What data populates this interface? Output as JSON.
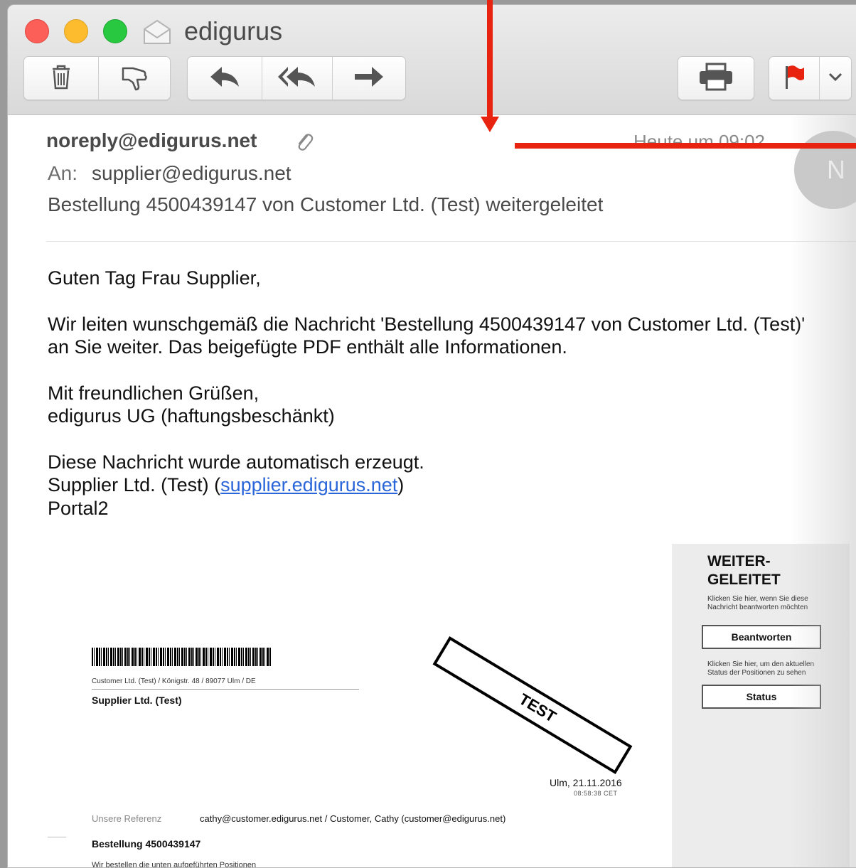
{
  "window": {
    "title": "edigurus",
    "icon": "envelope-icon"
  },
  "toolbar": {
    "buttons": [
      {
        "name": "delete-button",
        "icon": "trash-icon"
      },
      {
        "name": "junk-button",
        "icon": "thumbs-down-icon"
      },
      {
        "name": "reply-button",
        "icon": "reply-arrow-icon"
      },
      {
        "name": "reply-all-button",
        "icon": "reply-all-icon"
      },
      {
        "name": "forward-button",
        "icon": "forward-arrow-icon"
      },
      {
        "name": "print-button",
        "icon": "printer-icon"
      },
      {
        "name": "flag-button",
        "icon": "flag-icon"
      },
      {
        "name": "flag-menu-button",
        "icon": "chevron-down-icon"
      }
    ],
    "flag_color": "#e8230f"
  },
  "message": {
    "from": "noreply@edigurus.net",
    "to_label": "An:",
    "to": "supplier@edigurus.net",
    "subject": "Bestellung 4500439147 von Customer Ltd. (Test) weitergeleitet",
    "date": "Heute um 09:02",
    "avatar_initial": "N",
    "body": {
      "greeting": "Guten Tag Frau Supplier,",
      "p1_line1": "Wir leiten wunschgemäß die Nachricht 'Bestellung 4500439147 von Customer Ltd. (Test)'",
      "p1_line2": "an Sie weiter. Das beigefügte PDF enthält alle Informationen.",
      "closing": "Mit freundlichen Grüßen,",
      "company": "edigurus UG (haftungsbeschänkt)",
      "auto_note": "Diese Nachricht wurde automatisch erzeugt.",
      "portal_prefix": "Supplier Ltd. (Test) (",
      "portal_link": "supplier.edigurus.net",
      "portal_suffix": ")",
      "portal_name": "Portal2"
    }
  },
  "pdf": {
    "sender_line": "Customer Ltd. (Test) / Königstr. 48 / 89077 Ulm / DE",
    "recipient": "Supplier Ltd. (Test)",
    "stamp": "TEST",
    "city_date": "Ulm, 21.11.2016",
    "time": "08:58:38    CET",
    "ref_label": "Unsere Referenz",
    "ref_value": "cathy@customer.edigurus.net / Customer, Cathy (customer@edigurus.net)",
    "order": "Bestellung 4500439147",
    "cutoff_text": "Wir bestellen die unten aufgeführten Positionen",
    "panel": {
      "title_line1": "WEITER-",
      "title_line2": "GELEITET",
      "hint1_line1": "Klicken Sie hier, wenn Sie diese",
      "hint1_line2": "Nachricht beantworten möchten",
      "reply_button": "Beantworten",
      "hint2_line1": "Klicken Sie hier, um den aktuellen",
      "hint2_line2": "Status der Positionen zu sehen",
      "status_button": "Status"
    }
  },
  "annotation": {
    "color": "#e8230f"
  }
}
